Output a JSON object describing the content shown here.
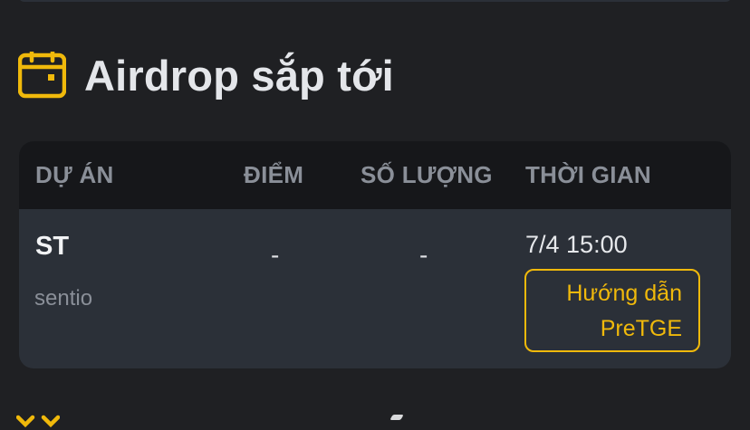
{
  "section": {
    "title": "Airdrop sắp tới",
    "icon": "calendar-icon"
  },
  "table": {
    "headers": {
      "project": "DỰ ÁN",
      "points": "ĐIỂM",
      "quantity": "SỐ LƯỢNG",
      "time": "THỜI GIAN"
    },
    "rows": [
      {
        "symbol": "ST",
        "name": "sentio",
        "points": "-",
        "quantity": "-",
        "time": "7/4 15:00",
        "guide_line1": "Hướng dẫn",
        "guide_line2": "PreTGE"
      }
    ]
  },
  "colors": {
    "background": "#1f2023",
    "header_bg": "#16171a",
    "row_bg": "#2b3038",
    "accent": "#f0b90b",
    "muted_text": "#8a8f98"
  }
}
